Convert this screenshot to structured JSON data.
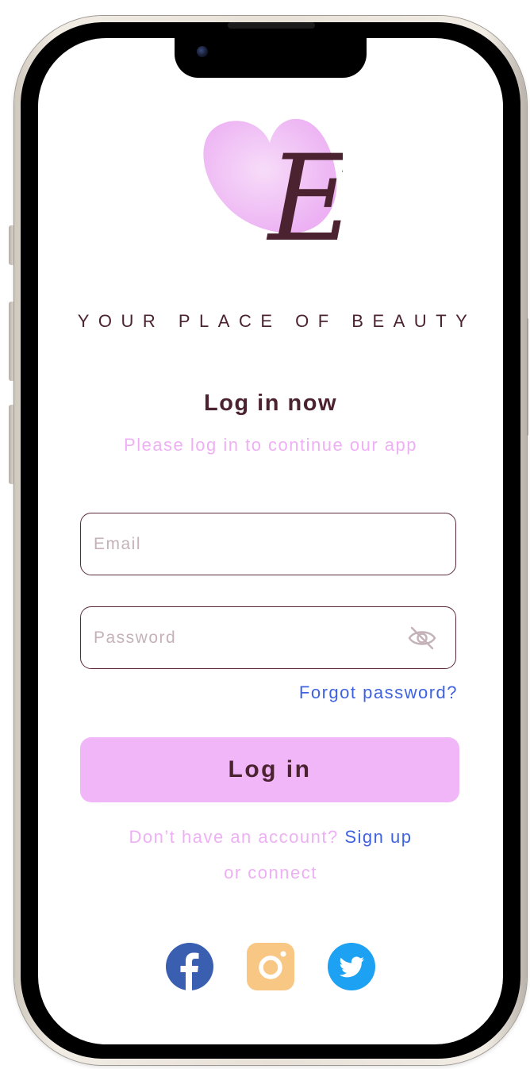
{
  "brand": {
    "logo_letter": "E",
    "tagline": "YOUR PLACE OF BEAUTY"
  },
  "login": {
    "title": "Log in now",
    "subtitle": "Please log in to continue our app",
    "email_placeholder": "Email",
    "email_value": "",
    "password_placeholder": "Password",
    "password_value": "",
    "forgot_label": "Forgot password?",
    "submit_label": "Log in"
  },
  "signup": {
    "prompt": "Don’t have an account?",
    "link_label": "Sign up",
    "or_connect": "or connect"
  },
  "social": [
    {
      "name": "facebook-icon",
      "color": "#3b5fb0"
    },
    {
      "name": "instagram-icon",
      "color": "#f9c784"
    },
    {
      "name": "twitter-icon",
      "color": "#1da1f2"
    }
  ],
  "colors": {
    "accent_pink": "#f0b6f7",
    "heading_maroon": "#4b2230",
    "link_blue": "#3f63e0",
    "muted_pink": "#eeb0f4"
  }
}
